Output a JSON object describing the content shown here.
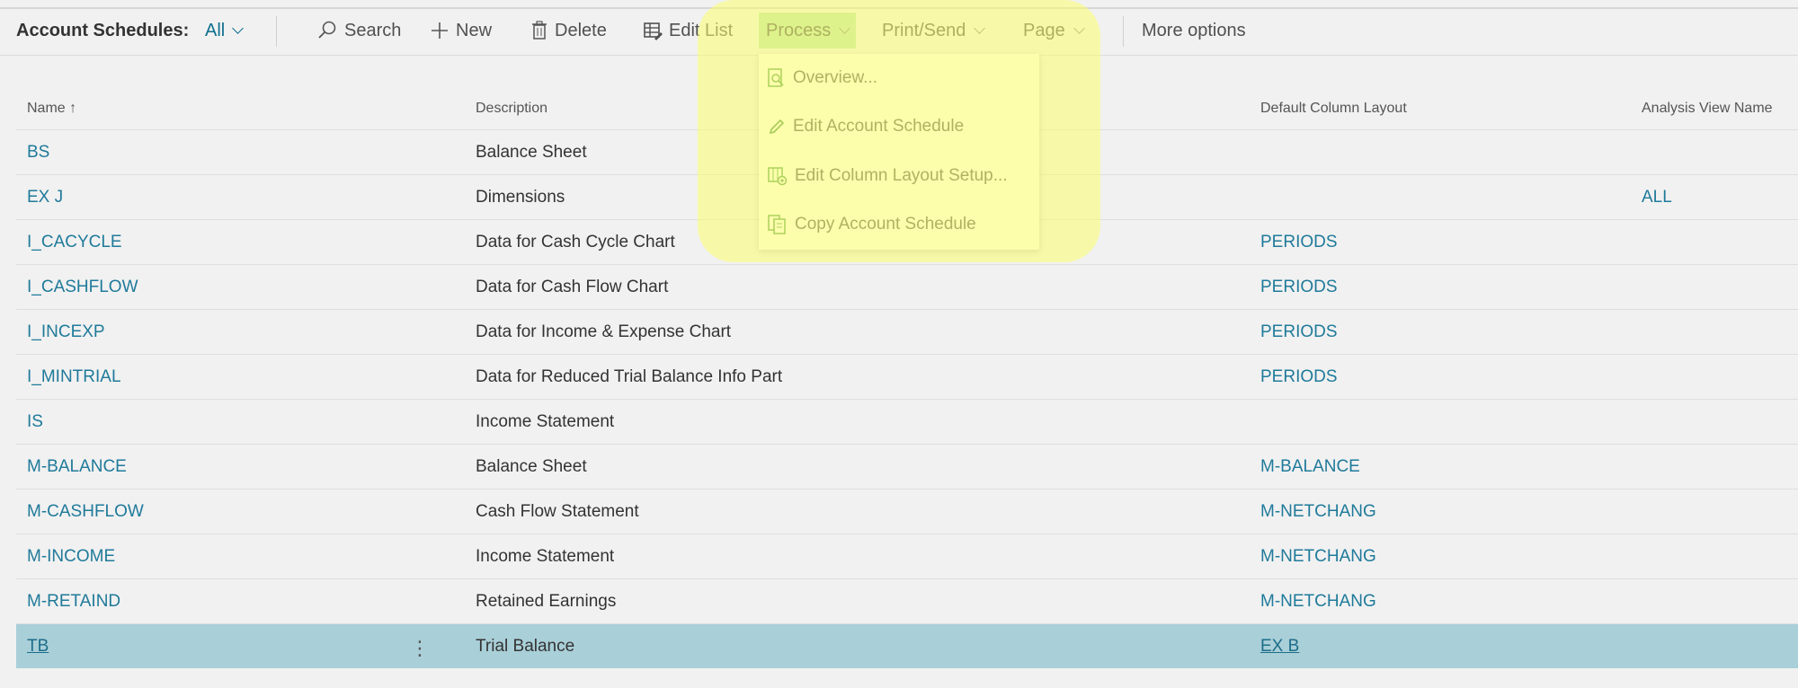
{
  "page": {
    "title": "Account Schedules:",
    "view_filter": "All"
  },
  "actionbar": {
    "search": "Search",
    "new": "New",
    "delete": "Delete",
    "edit_list": "Edit List",
    "process": "Process",
    "print_send": "Print/Send",
    "page_menu": "Page",
    "more_options": "More options"
  },
  "process_menu": {
    "items": [
      {
        "label": "Overview...",
        "icon": "overview-icon"
      },
      {
        "label": "Edit Account Schedule",
        "icon": "pencil-icon"
      },
      {
        "label": "Edit Column Layout Setup...",
        "icon": "column-layout-icon"
      },
      {
        "label": "Copy Account Schedule",
        "icon": "copy-icon"
      }
    ]
  },
  "table": {
    "headers": {
      "name": "Name",
      "name_sort": "↑",
      "description": "Description",
      "default_column_layout": "Default Column Layout",
      "analysis_view_name": "Analysis View Name"
    },
    "rows": [
      {
        "name": "BS",
        "description": "Balance Sheet",
        "layout": "",
        "analysis_view": ""
      },
      {
        "name": "EX J",
        "description": "Dimensions",
        "layout": "",
        "analysis_view": "ALL"
      },
      {
        "name": "I_CACYCLE",
        "description": "Data for Cash Cycle Chart",
        "layout": "PERIODS",
        "analysis_view": ""
      },
      {
        "name": "I_CASHFLOW",
        "description": "Data for Cash Flow Chart",
        "layout": "PERIODS",
        "analysis_view": ""
      },
      {
        "name": "I_INCEXP",
        "description": "Data for Income & Expense Chart",
        "layout": "PERIODS",
        "analysis_view": ""
      },
      {
        "name": "I_MINTRIAL",
        "description": "Data for Reduced Trial Balance Info Part",
        "layout": "PERIODS",
        "analysis_view": ""
      },
      {
        "name": "IS",
        "description": "Income Statement",
        "layout": "",
        "analysis_view": ""
      },
      {
        "name": "M-BALANCE",
        "description": "Balance Sheet",
        "layout": "M-BALANCE",
        "analysis_view": ""
      },
      {
        "name": "M-CASHFLOW",
        "description": "Cash Flow Statement",
        "layout": "M-NETCHANG",
        "analysis_view": ""
      },
      {
        "name": "M-INCOME",
        "description": "Income Statement",
        "layout": "M-NETCHANG",
        "analysis_view": ""
      },
      {
        "name": "M-RETAIND",
        "description": "Retained Earnings",
        "layout": "M-NETCHANG",
        "analysis_view": ""
      },
      {
        "name": "TB",
        "description": "Trial Balance",
        "layout": "EX B",
        "analysis_view": "",
        "selected": true,
        "kebab": "⋮"
      }
    ]
  },
  "colors": {
    "link": "#1f7a9a",
    "selected_row": "#a9cfd8",
    "highlight": "#fcff6e",
    "process_active": "#8cd778"
  }
}
